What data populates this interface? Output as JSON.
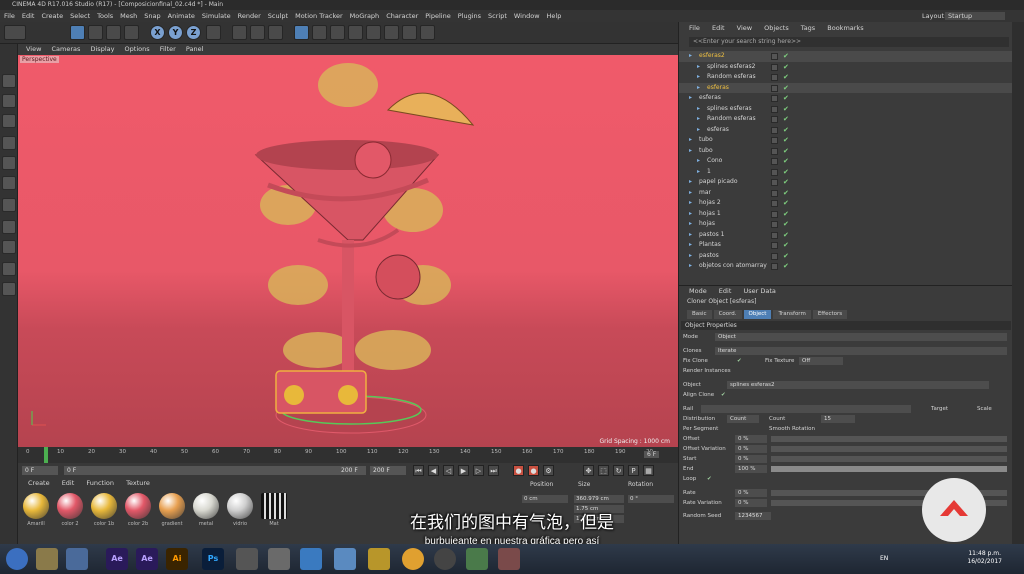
{
  "window": {
    "title": "CINEMA 4D R17.016 Studio (R17) - [Composicionfinal_02.c4d *] - Main"
  },
  "menubar": {
    "items": [
      "File",
      "Edit",
      "Create",
      "Select",
      "Tools",
      "Mesh",
      "Snap",
      "Animate",
      "Simulate",
      "Render",
      "Sculpt",
      "Motion Tracker",
      "MoGraph",
      "Character",
      "Pipeline",
      "Plugins",
      "Script",
      "Window",
      "Help"
    ],
    "layout_label": "Layout:",
    "layout_value": "Startup"
  },
  "toolbar": {
    "axes": [
      "X",
      "Y",
      "Z"
    ]
  },
  "viewport": {
    "menu": [
      "View",
      "Cameras",
      "Display",
      "Options",
      "Filter",
      "Panel"
    ],
    "label": "Perspective",
    "grid_spacing": "Grid Spacing : 1000 cm"
  },
  "timeline": {
    "ticks": [
      "0",
      "10",
      "20",
      "30",
      "40",
      "50",
      "60",
      "70",
      "80",
      "90",
      "100",
      "110",
      "120",
      "130",
      "140",
      "150",
      "160",
      "170",
      "180",
      "190",
      "20"
    ],
    "current_frame": "6 F",
    "start": "0 F",
    "min": "0 F",
    "max": "200 F",
    "end": "200 F"
  },
  "material_manager": {
    "menu": [
      "Create",
      "Edit",
      "Function",
      "Texture"
    ],
    "materials": [
      {
        "name": "Amarill",
        "color": "#e8b83a"
      },
      {
        "name": "color 2",
        "color": "#e25868"
      },
      {
        "name": "color 1b",
        "color": "#e8b83a"
      },
      {
        "name": "color 2b",
        "color": "#e25868"
      },
      {
        "name": "gradient",
        "color": "#e8a050"
      },
      {
        "name": "metal",
        "color": "#d8d8d0"
      },
      {
        "name": "vidrio",
        "color": "#cfcfcf"
      },
      {
        "name": "Mat",
        "color": "#222222"
      }
    ]
  },
  "coord_manager": {
    "headers": [
      "Position",
      "Size",
      "Rotation"
    ],
    "x_pos": "0 cm",
    "x_size": "360.979 cm",
    "x_rot": "0 °",
    "y_size": "1.75 cm",
    "z_size": "1.262 cm"
  },
  "object_manager": {
    "menu": [
      "File",
      "Edit",
      "View",
      "Objects",
      "Tags",
      "Bookmarks"
    ],
    "search_placeholder": "<<Enter your search string here>>",
    "objects": [
      {
        "name": "esferas2",
        "indent": 0
      },
      {
        "name": "splines esferas2",
        "indent": 1
      },
      {
        "name": "Random esferas",
        "indent": 1
      },
      {
        "name": "esferas",
        "indent": 1
      },
      {
        "name": "esferas",
        "indent": 0
      },
      {
        "name": "splines esferas",
        "indent": 1
      },
      {
        "name": "Random esferas",
        "indent": 1
      },
      {
        "name": "esferas",
        "indent": 1
      },
      {
        "name": "tubo",
        "indent": 0
      },
      {
        "name": "tubo",
        "indent": 0
      },
      {
        "name": "Cono",
        "indent": 1
      },
      {
        "name": "1",
        "indent": 1
      },
      {
        "name": "papel picado",
        "indent": 0
      },
      {
        "name": "mar",
        "indent": 0
      },
      {
        "name": "hojas 2",
        "indent": 0
      },
      {
        "name": "hojas 1",
        "indent": 0
      },
      {
        "name": "hojas",
        "indent": 0
      },
      {
        "name": "pastos 1",
        "indent": 0
      },
      {
        "name": "Plantas",
        "indent": 0
      },
      {
        "name": "pastos",
        "indent": 0
      },
      {
        "name": "objetos con atomarray",
        "indent": 0
      }
    ]
  },
  "attribute_manager": {
    "menu": [
      "Mode",
      "Edit",
      "User Data"
    ],
    "title": "Cloner Object [esferas]",
    "tabs": [
      "Basic",
      "Coord.",
      "Object",
      "Transform",
      "Effectors"
    ],
    "active_tab": "Object",
    "section": "Object Properties",
    "mode_label": "Mode",
    "mode_value": "Object",
    "clones_label": "Clones",
    "clones_value": "Iterate",
    "fix_clone_label": "Fix Clone",
    "fix_texture_label": "Fix Texture",
    "fix_texture_value": "Off",
    "render_instances_label": "Render Instances",
    "object_label": "Object",
    "object_value": "splines esferas2",
    "align_clone_label": "Align Clone",
    "rail_label": "Rail",
    "target_label": "Target",
    "scale_label": "Scale",
    "distribution_label": "Distribution",
    "distribution_value": "Count",
    "count_label": "Count",
    "count_value": "15",
    "per_segment_label": "Per Segment",
    "smooth_rotation_label": "Smooth Rotation",
    "offset_label": "Offset",
    "offset_value": "0 %",
    "offset_variation_label": "Offset Variation",
    "offset_variation_value": "0 %",
    "start_label": "Start",
    "start_value": "0 %",
    "end_label": "End",
    "end_value": "100 %",
    "loop_label": "Loop",
    "rate_label": "Rate",
    "rate_value": "0 %",
    "rate_variation_label": "Rate Variation",
    "rate_variation_value": "0 %",
    "random_seed_label": "Random Seed",
    "random_seed_value": "1234567"
  },
  "subtitles": {
    "chinese": "在我们的图中有气泡，但是",
    "spanish": "burbujeante en nuestra gráfica pero así"
  },
  "taskbar": {
    "apps": [
      "Ae",
      "Ae",
      "Ai",
      "Ps"
    ],
    "lang": "EN",
    "time": "11:48 p.m.",
    "date": "16/02/2017"
  },
  "colors": {
    "viewport_bg": "#f05a6a",
    "accent": "#4e7fb5",
    "badge_red": "#e53935"
  }
}
